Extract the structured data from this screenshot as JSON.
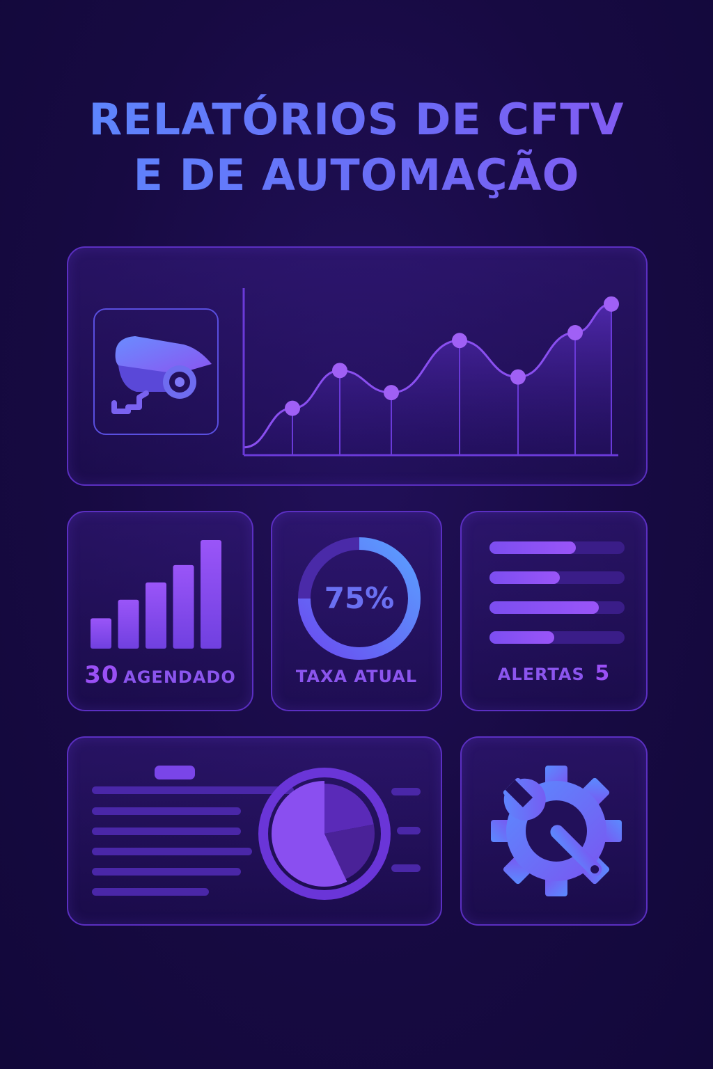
{
  "header": {
    "title_line1": "RELATÓRIOS DE CFTV",
    "title_line2": "E DE AUTOMAÇÃO"
  },
  "colors": {
    "background": "#170a42",
    "panel_border": "#5b2fc2",
    "accent_blue": "#5a8cff",
    "accent_purple": "#9a50f5"
  },
  "icons": {
    "camera": "cctv-camera-icon",
    "settings": "gear-wrench-icon"
  },
  "trend_chart": {
    "type": "area",
    "points": [
      {
        "x": 0,
        "y": 6
      },
      {
        "x": 1,
        "y": 36
      },
      {
        "x": 2,
        "y": 65
      },
      {
        "x": 3,
        "y": 48
      },
      {
        "x": 4,
        "y": 88
      },
      {
        "x": 5,
        "y": 60
      },
      {
        "x": 6,
        "y": 94
      },
      {
        "x": 7,
        "y": 116
      }
    ],
    "marked_points": [
      1,
      2,
      3,
      4,
      5,
      6,
      7
    ],
    "ylim": [
      0,
      125
    ],
    "grid": false
  },
  "bars_card": {
    "count": "30",
    "label": "AGENDADO",
    "bar_levels": [
      0.28,
      0.45,
      0.61,
      0.77,
      1.0
    ]
  },
  "gauge_card": {
    "value_text": "75%",
    "value": 0.75,
    "label": "TAXA ATUAL"
  },
  "alerts_card": {
    "label": "ALERTAS",
    "count": "5",
    "levels": [
      0.64,
      0.52,
      0.81,
      0.48
    ]
  },
  "report_card": {
    "pie_slices": [
      0.22,
      0.21,
      0.57
    ]
  }
}
